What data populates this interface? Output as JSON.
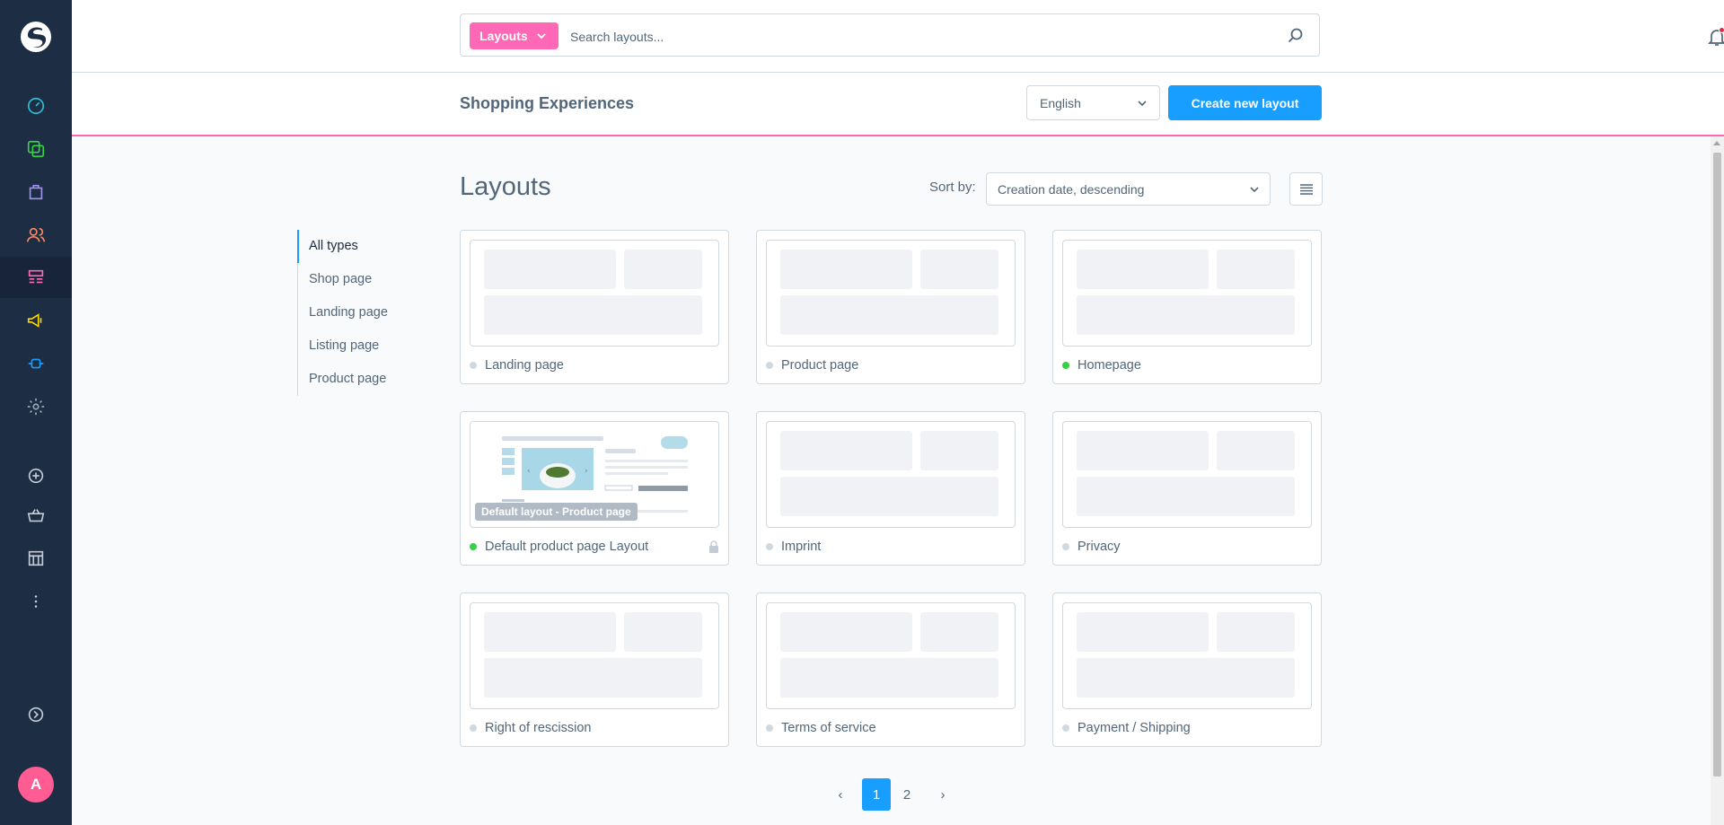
{
  "header": {
    "search_type": "Layouts",
    "search_placeholder": "Search layouts..."
  },
  "smartbar": {
    "title": "Shopping Experiences",
    "language": "English",
    "create_button": "Create new layout"
  },
  "content": {
    "title": "Layouts",
    "sort_label": "Sort by:",
    "sort_value": "Creation date, descending"
  },
  "filters": [
    "All types",
    "Shop page",
    "Landing page",
    "Listing page",
    "Product page"
  ],
  "cards": [
    {
      "name": "Landing page",
      "active": false
    },
    {
      "name": "Product page",
      "active": false
    },
    {
      "name": "Homepage",
      "active": true
    },
    {
      "name": "Default product page Layout",
      "active": true,
      "tag": "Default layout - Product page",
      "locked": true
    },
    {
      "name": "Imprint",
      "active": false
    },
    {
      "name": "Privacy",
      "active": false
    },
    {
      "name": "Right of rescission",
      "active": false
    },
    {
      "name": "Terms of service",
      "active": false
    },
    {
      "name": "Payment / Shipping",
      "active": false
    }
  ],
  "pagination": {
    "prev": "‹",
    "pages": [
      "1",
      "2"
    ],
    "next": "›",
    "current": "1"
  },
  "user": {
    "avatar_initial": "A"
  },
  "colors": {
    "accent": "#189eff",
    "brand": "#ff68b4",
    "sidebar": "#1d2d43",
    "status_active": "#37d046"
  },
  "sidebar_icons": [
    "dashboard-icon",
    "catalog-icon",
    "orders-icon",
    "customers-icon",
    "content-icon",
    "marketing-icon",
    "extensions-icon",
    "settings-icon",
    "add-sales-channel-icon",
    "storefront-icon",
    "headless-icon",
    "more-icon",
    "expand-sidebar-icon"
  ]
}
